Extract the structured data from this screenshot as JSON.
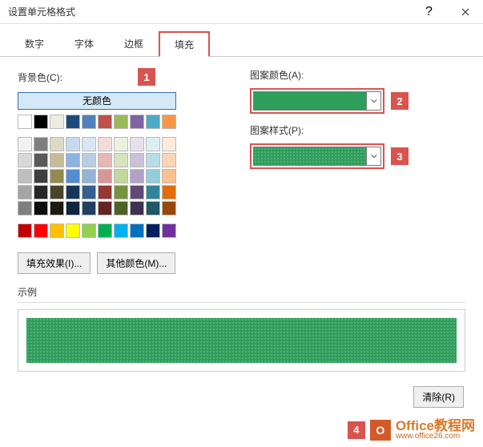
{
  "window": {
    "title": "设置单元格格式"
  },
  "tabs": {
    "number": "数字",
    "font": "字体",
    "border": "边框",
    "fill": "填充"
  },
  "left": {
    "bg_label": "背景色(C):",
    "no_color": "无颜色",
    "effects_btn": "填充效果(I)...",
    "more_colors_btn": "其他颜色(M)..."
  },
  "right": {
    "pattern_color_label": "图案颜色(A):",
    "pattern_style_label": "图案样式(P):"
  },
  "sample_label": "示例",
  "clear_btn": "清除(R)",
  "callouts": {
    "c1": "1",
    "c2": "2",
    "c3": "3",
    "c4": "4"
  },
  "watermark": {
    "brand": "Office教程网",
    "url": "www.office26.com"
  },
  "palette_top": [
    "#ffffff",
    "#000000",
    "#eeece1",
    "#1f497d",
    "#4f81bd",
    "#c0504d",
    "#9bbb59",
    "#8064a2",
    "#4bacc6",
    "#f79646"
  ],
  "palette_grid": [
    "#f2f2f2",
    "#7f7f7f",
    "#ddd9c3",
    "#c6d9f0",
    "#dbe5f1",
    "#f2dcdb",
    "#ebf1dd",
    "#e5e0ec",
    "#dbeef3",
    "#fdeada",
    "#d8d8d8",
    "#595959",
    "#c4bd97",
    "#8db3e2",
    "#b8cce4",
    "#e5b9b7",
    "#d7e3bc",
    "#ccc1d9",
    "#b7dde8",
    "#fbd5b5",
    "#bfbfbf",
    "#3f3f3f",
    "#938953",
    "#548dd4",
    "#95b3d7",
    "#d99694",
    "#c3d69b",
    "#b2a2c7",
    "#92cddc",
    "#fac08f",
    "#a5a5a5",
    "#262626",
    "#494429",
    "#17365d",
    "#366092",
    "#953734",
    "#76923c",
    "#5f497a",
    "#31859b",
    "#e36c09",
    "#7f7f7f",
    "#0c0c0c",
    "#1d1b10",
    "#0f243e",
    "#244061",
    "#632423",
    "#4f6128",
    "#3f3151",
    "#205867",
    "#974806"
  ],
  "palette_bottom": [
    "#c00000",
    "#ff0000",
    "#ffc000",
    "#ffff00",
    "#92d050",
    "#00b050",
    "#00b0f0",
    "#0070c0",
    "#002060",
    "#7030a0"
  ]
}
